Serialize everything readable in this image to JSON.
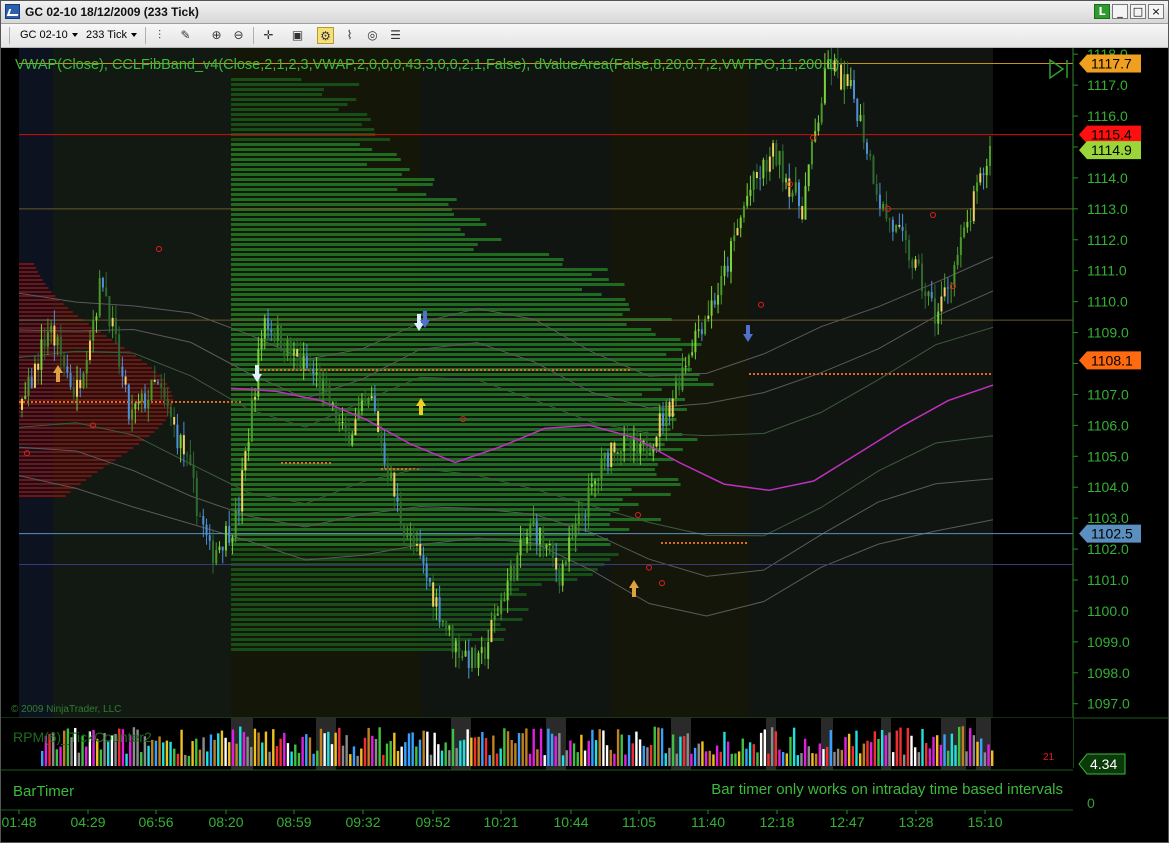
{
  "window": {
    "title": "GC 02-10  18/12/2009 (233 Tick)",
    "controls": [
      "L",
      "_",
      "□",
      "×"
    ]
  },
  "toolbar": {
    "instrument": "GC 02-10",
    "interval": "233 Tick"
  },
  "indicators_label": "VWAP(Close),  CCLFibBand_v4(Close,2,1,2,3,VWAP,2,0,0,0,43,3,0,0,2,1,False),  dValueArea(False,8,20,0.7,2,VWTPO,11,200,1)",
  "copyright": "© 2009 NinjaTrader, LLC",
  "price_axis": {
    "ticks": [
      "1118.0",
      "1117.0",
      "1116.0",
      "1115.0",
      "1114.0",
      "1113.0",
      "1112.0",
      "1111.0",
      "1110.0",
      "1109.0",
      "1108.0",
      "1107.0",
      "1106.0",
      "1105.0",
      "1104.0",
      "1103.0",
      "1102.0",
      "1101.0",
      "1100.0",
      "1099.0",
      "1098.0",
      "1097.0"
    ],
    "ylim": [
      1096.7,
      1118.2
    ]
  },
  "price_labels": [
    {
      "text": "1117.7",
      "value": 1117.7,
      "color": "#f0a020"
    },
    {
      "text": "1115.4",
      "value": 1115.4,
      "color": "#ff1010"
    },
    {
      "text": "1114.9",
      "value": 1114.9,
      "color": "#9ad63a"
    },
    {
      "text": "1108.1",
      "value": 1108.1,
      "color": "#ff6a10"
    },
    {
      "text": "1102.5",
      "value": 1102.5,
      "color": "#5a8fc0"
    }
  ],
  "h_lines": [
    {
      "value": 1117.7,
      "color": "#c89020"
    },
    {
      "value": 1115.4,
      "color": "#d01010"
    },
    {
      "value": 1113.0,
      "color": "#6a5a2a"
    },
    {
      "value": 1109.4,
      "color": "#6a5a2a"
    },
    {
      "value": 1102.5,
      "color": "#5a8fc0"
    },
    {
      "value": 1101.5,
      "color": "#3a3a7a"
    }
  ],
  "lower_panel": {
    "label": "RPM(6)_TickCounter2",
    "counter_text": "21",
    "value_label": "4.34",
    "bartimer_label": "BarTimer",
    "bartimer_message": "Bar timer only works on intraday time based intervals",
    "zero_tick": "0"
  },
  "time_axis": [
    "01:48",
    "04:29",
    "06:56",
    "08:20",
    "08:59",
    "09:32",
    "09:52",
    "10:21",
    "10:44",
    "11:05",
    "11:40",
    "12:18",
    "12:47",
    "13:28",
    "15:10"
  ],
  "chart_data": {
    "type": "candlestick",
    "ylim": [
      1096.7,
      1118.2
    ],
    "x": [
      "01:48",
      "04:29",
      "06:56",
      "08:20",
      "08:59",
      "09:32",
      "09:52",
      "10:21",
      "10:44",
      "11:05",
      "11:40",
      "12:18",
      "12:47",
      "13:28",
      "15:10"
    ],
    "close_path": [
      1106.5,
      1109.2,
      1107.0,
      1110.8,
      1106.2,
      1107.3,
      1105.2,
      1101.8,
      1103.0,
      1109.5,
      1108.3,
      1107.5,
      1105.6,
      1106.8,
      1103.2,
      1101.2,
      1099.0,
      1098.2,
      1100.8,
      1102.8,
      1101.2,
      1103.5,
      1105.5,
      1105.0,
      1106.5,
      1108.9,
      1110.5,
      1113.5,
      1114.8,
      1113.0,
      1117.8,
      1116.5,
      1113.0,
      1111.5,
      1109.5,
      1112.0,
      1114.9
    ],
    "series": [
      {
        "name": "VWAP",
        "color": "#c030c0",
        "values": [
          1107.2,
          1107.1,
          1106.8,
          1106.2,
          1105.4,
          1104.8,
          1105.3,
          1105.9,
          1106.0,
          1105.6,
          1104.8,
          1104.1,
          1103.9,
          1104.2,
          1105.1,
          1106.0,
          1106.8,
          1107.3
        ]
      }
    ]
  }
}
